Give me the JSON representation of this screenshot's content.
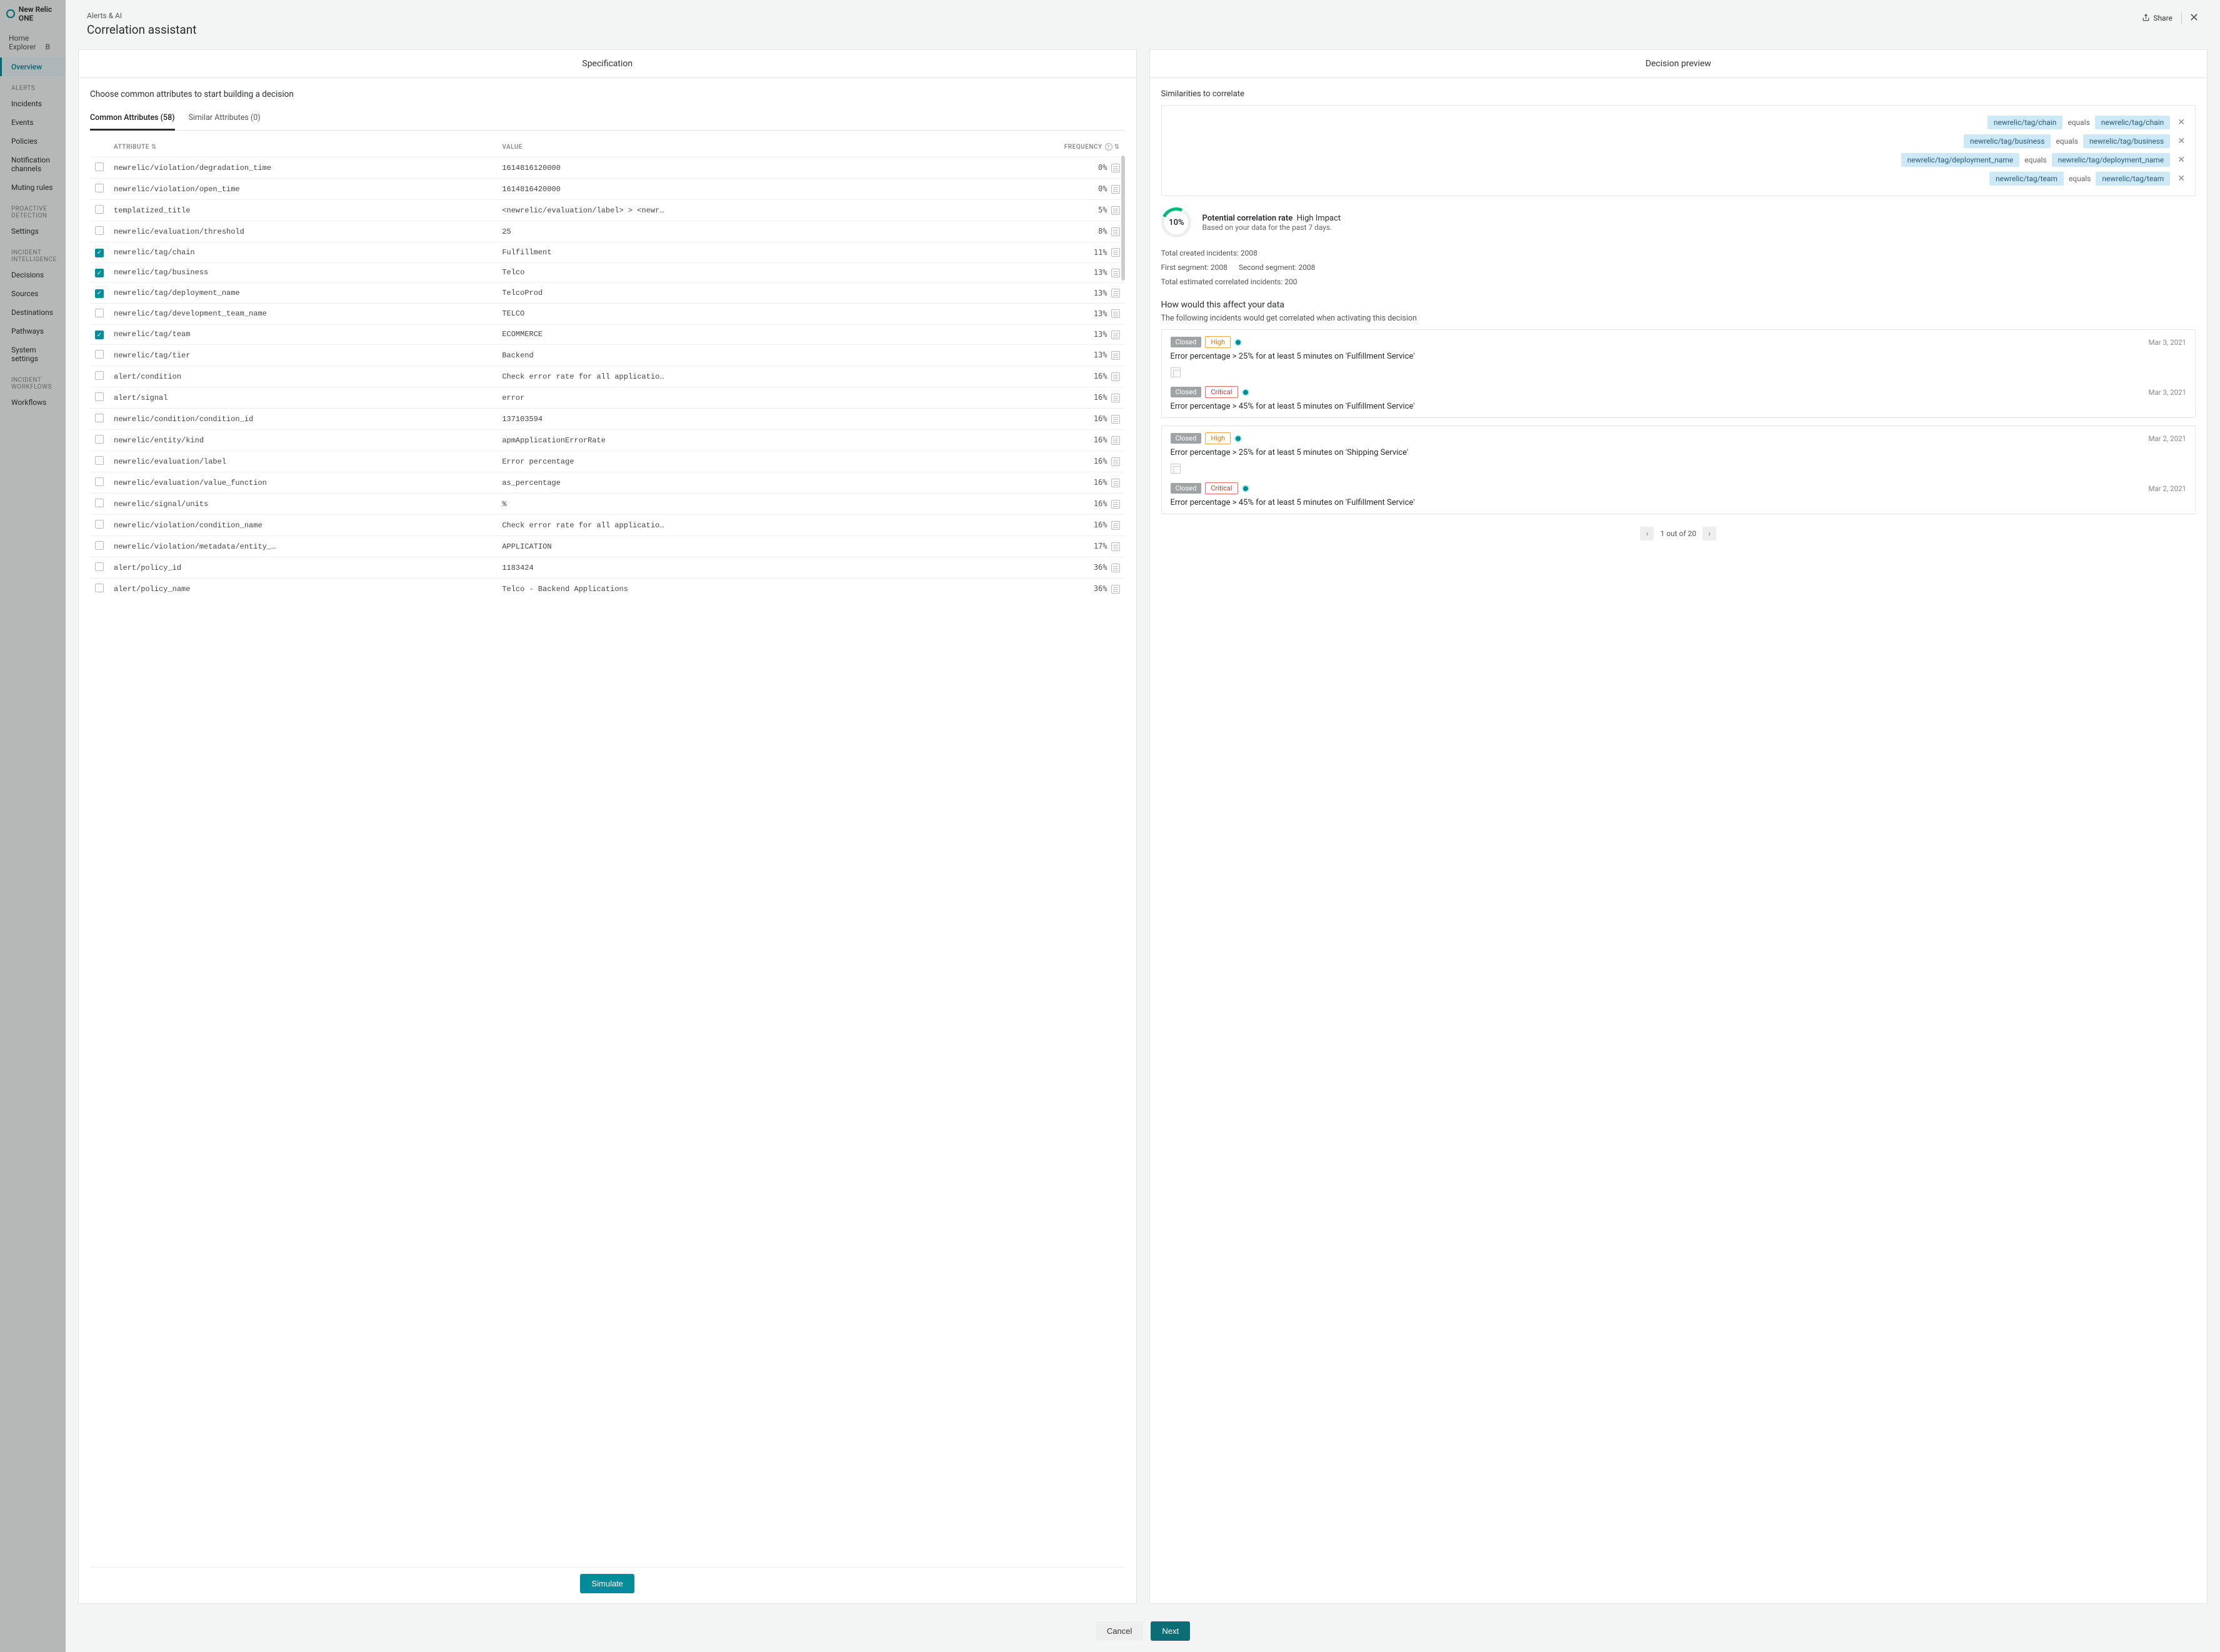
{
  "brand": "New Relic ONE",
  "bg_nav": {
    "items": [
      "Home",
      "Explorer",
      "B"
    ],
    "overview": "Overview"
  },
  "sidebar": {
    "sections": [
      {
        "label": "ALERTS",
        "items": [
          "Incidents",
          "Events",
          "Policies",
          "Notification channels",
          "Muting rules"
        ]
      },
      {
        "label": "PROACTIVE DETECTION",
        "items": [
          "Settings"
        ]
      },
      {
        "label": "INCIDENT INTELLIGENCE",
        "items": [
          "Decisions",
          "Sources",
          "Destinations",
          "Pathways",
          "System settings"
        ]
      },
      {
        "label": "INCIDENT WORKFLOWS",
        "items": [
          "Workflows"
        ]
      }
    ]
  },
  "header": {
    "breadcrumb": "Alerts & AI",
    "title": "Correlation assistant",
    "share": "Share"
  },
  "left": {
    "panel_title": "Specification",
    "subheading": "Choose common attributes to start building a decision",
    "tabs": [
      {
        "label": "Common Attributes (58)",
        "active": true
      },
      {
        "label": "Similar Attributes (0)",
        "active": false
      }
    ],
    "columns": {
      "attr": "ATTRIBUTE",
      "value": "VALUE",
      "freq": "FREQUENCY"
    },
    "rows": [
      {
        "checked": false,
        "attr": "newrelic/violation/degradation_time",
        "value": "1614816120000",
        "freq": "0%"
      },
      {
        "checked": false,
        "attr": "newrelic/violation/open_time",
        "value": "1614816420000",
        "freq": "0%"
      },
      {
        "checked": false,
        "attr": "templatized_title",
        "value": "<newrelic/evaluation/label> > <newr…",
        "freq": "5%"
      },
      {
        "checked": false,
        "attr": "newrelic/evaluation/threshold",
        "value": "25",
        "freq": "8%"
      },
      {
        "checked": true,
        "attr": "newrelic/tag/chain",
        "value": "Fulfillment",
        "freq": "11%"
      },
      {
        "checked": true,
        "attr": "newrelic/tag/business",
        "value": "Telco",
        "freq": "13%"
      },
      {
        "checked": true,
        "attr": "newrelic/tag/deployment_name",
        "value": "TelcoProd",
        "freq": "13%"
      },
      {
        "checked": false,
        "attr": "newrelic/tag/development_team_name",
        "value": "TELCO",
        "freq": "13%"
      },
      {
        "checked": true,
        "attr": "newrelic/tag/team",
        "value": "ECOMMERCE",
        "freq": "13%"
      },
      {
        "checked": false,
        "attr": "newrelic/tag/tier",
        "value": "Backend",
        "freq": "13%"
      },
      {
        "checked": false,
        "attr": "alert/condition",
        "value": "Check error rate for all applicatio…",
        "freq": "16%"
      },
      {
        "checked": false,
        "attr": "alert/signal",
        "value": "error",
        "freq": "16%"
      },
      {
        "checked": false,
        "attr": "newrelic/condition/condition_id",
        "value": "137103594",
        "freq": "16%"
      },
      {
        "checked": false,
        "attr": "newrelic/entity/kind",
        "value": "apmApplicationErrorRate",
        "freq": "16%"
      },
      {
        "checked": false,
        "attr": "newrelic/evaluation/label",
        "value": "Error percentage",
        "freq": "16%"
      },
      {
        "checked": false,
        "attr": "newrelic/evaluation/value_function",
        "value": "as_percentage",
        "freq": "16%"
      },
      {
        "checked": false,
        "attr": "newrelic/signal/units",
        "value": "%",
        "freq": "16%"
      },
      {
        "checked": false,
        "attr": "newrelic/violation/condition_name",
        "value": "Check error rate for all applicatio…",
        "freq": "16%"
      },
      {
        "checked": false,
        "attr": "newrelic/violation/metadata/entity_…",
        "value": "APPLICATION",
        "freq": "17%"
      },
      {
        "checked": false,
        "attr": "alert/policy_id",
        "value": "1183424",
        "freq": "36%"
      },
      {
        "checked": false,
        "attr": "alert/policy_name",
        "value": "Telco - Backend Applications",
        "freq": "36%"
      }
    ],
    "simulate": "Simulate"
  },
  "right": {
    "panel_title": "Decision preview",
    "sim_title": "Similarities to correlate",
    "rules": [
      {
        "left": "newrelic/tag/chain",
        "op": "equals",
        "right": "newrelic/tag/chain"
      },
      {
        "left": "newrelic/tag/business",
        "op": "equals",
        "right": "newrelic/tag/business"
      },
      {
        "left": "newrelic/tag/deployment_name",
        "op": "equals",
        "right": "newrelic/tag/deployment_name"
      },
      {
        "left": "newrelic/tag/team",
        "op": "equals",
        "right": "newrelic/tag/team"
      }
    ],
    "gauge": "10%",
    "corr_label": "Potential correlation rate",
    "corr_impact": "High Impact",
    "corr_sub": "Based on your data for the past 7 days.",
    "stats": {
      "created": "Total created incidents: 2008",
      "seg1": "First segment: 2008",
      "seg2": "Second segment: 2008",
      "est": "Total estimated correlated incidents: 200"
    },
    "affect_title": "How would this affect your data",
    "affect_sub": "The following incidents would get correlated when activating this decision",
    "incidents": [
      {
        "parts": [
          {
            "status": "Closed",
            "severity": "High",
            "date": "Mar 3, 2021",
            "title": "Error percentage > 25% for at least 5 minutes on 'Fulfillment Service'"
          },
          {
            "status": "Closed",
            "severity": "Critical",
            "date": "Mar 3, 2021",
            "title": "Error percentage > 45% for at least 5 minutes on 'Fulfillment Service'"
          }
        ]
      },
      {
        "parts": [
          {
            "status": "Closed",
            "severity": "High",
            "date": "Mar 2, 2021",
            "title": "Error percentage > 25% for at least 5 minutes on 'Shipping Service'"
          },
          {
            "status": "Closed",
            "severity": "Critical",
            "date": "Mar 2, 2021",
            "title": "Error percentage > 45% for at least 5 minutes on 'Fulfillment Service'"
          }
        ]
      }
    ],
    "pager": "1 out of 20"
  },
  "footer": {
    "cancel": "Cancel",
    "next": "Next"
  }
}
